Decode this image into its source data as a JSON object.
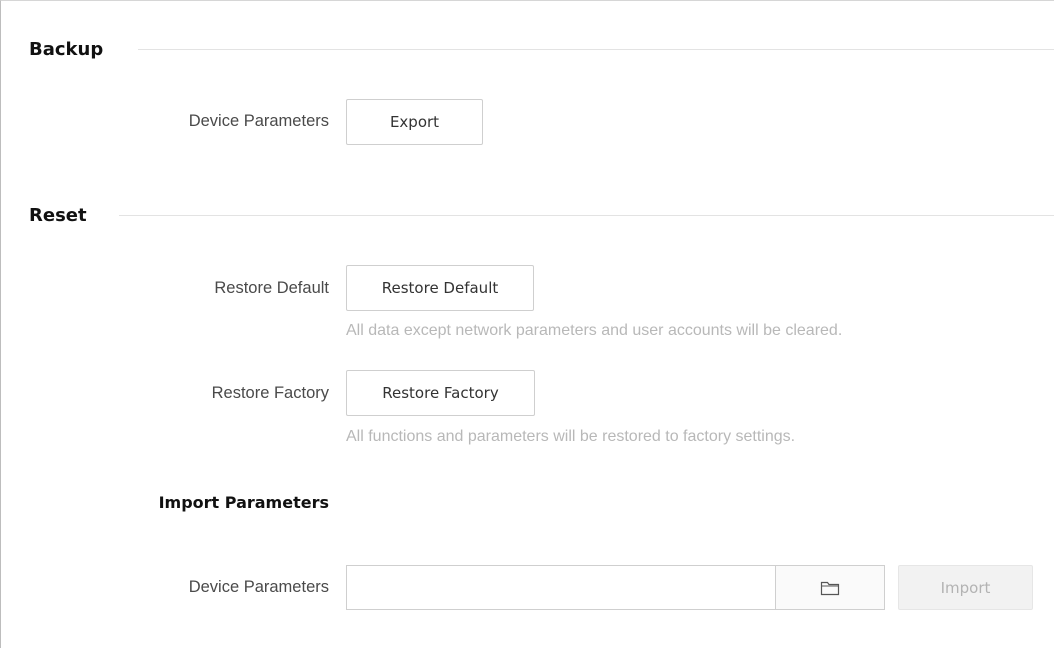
{
  "backup": {
    "title": "Backup",
    "device_parameters_label": "Device Parameters",
    "export_label": "Export"
  },
  "reset": {
    "title": "Reset",
    "restore_default_label": "Restore Default",
    "restore_default_button": "Restore Default",
    "restore_default_hint": "All data except network parameters and user accounts will be cleared.",
    "restore_factory_label": "Restore Factory",
    "restore_factory_button": "Restore Factory",
    "restore_factory_hint": "All functions and parameters will be restored to factory settings."
  },
  "import": {
    "title": "Import Parameters",
    "device_parameters_label": "Device Parameters",
    "file_value": "",
    "file_placeholder": "",
    "browse_icon": "folder-icon",
    "import_label": "Import",
    "import_disabled": true
  },
  "colors": {
    "hint": "#b8b8b8",
    "border": "#cfcfcf",
    "disabled_bg": "#f2f2f2"
  }
}
